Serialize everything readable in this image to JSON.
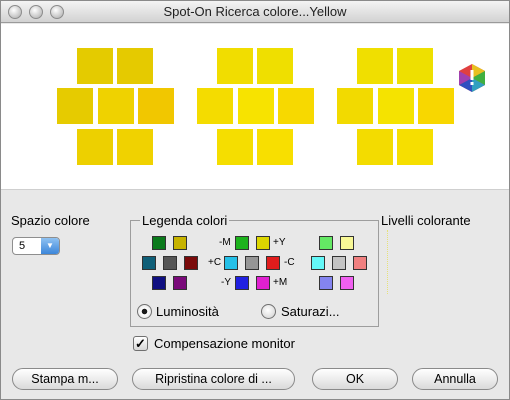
{
  "window": {
    "title": "Spot-On Ricerca colore...Yellow"
  },
  "preview": {
    "groups": [
      {
        "swatches": [
          "#e4cb00",
          "#e5ca00",
          "#e6cb00",
          "#efd200",
          "#f1c700",
          "#edd000",
          "#f0d200"
        ]
      },
      {
        "swatches": [
          "#f1dd00",
          "#efdf00",
          "#f4dc00",
          "#f7e300",
          "#f7d900",
          "#f5de00",
          "#f8df00"
        ]
      },
      {
        "swatches": [
          "#f0df00",
          "#eee000",
          "#f2da00",
          "#f5e300",
          "#f8d700",
          "#f3dc00",
          "#f6df00"
        ]
      }
    ],
    "logo_icon": "color-wheel-icon"
  },
  "color_space": {
    "label": "Spazio colore",
    "value": "5"
  },
  "legend": {
    "title": "Legenda colori",
    "swatches": [
      "#0b7a1c",
      "#c7b300",
      "#0f5f78",
      "#555555",
      "#7a0a0a",
      "#0f0f80",
      "#7a0a7a",
      "#1db31d",
      "#dcd600",
      "#25c0e8",
      "#969696",
      "#e01c1c",
      "#2020e0",
      "#e020d0",
      "#64e864",
      "#f8f896",
      "#64f8f8",
      "#c4c4c4",
      "#f08080",
      "#8484f0",
      "#f060f0"
    ],
    "signs": {
      "minus_m": "-M",
      "plus_y": "+Y",
      "plus_c": "+C",
      "minus_c": "-C",
      "minus_y": "-Y",
      "plus_m": "+M"
    },
    "radio_luminosity": "Luminosità",
    "radio_saturation": "Saturazi...",
    "selected": "Luminosità"
  },
  "levels": {
    "label": "Livelli colorante"
  },
  "monitor_compensation": {
    "label": "Compensazione monitor",
    "checked": true
  },
  "buttons": {
    "print": "Stampa m...",
    "restore": "Ripristina colore di ...",
    "ok": "OK",
    "cancel": "Annulla"
  }
}
